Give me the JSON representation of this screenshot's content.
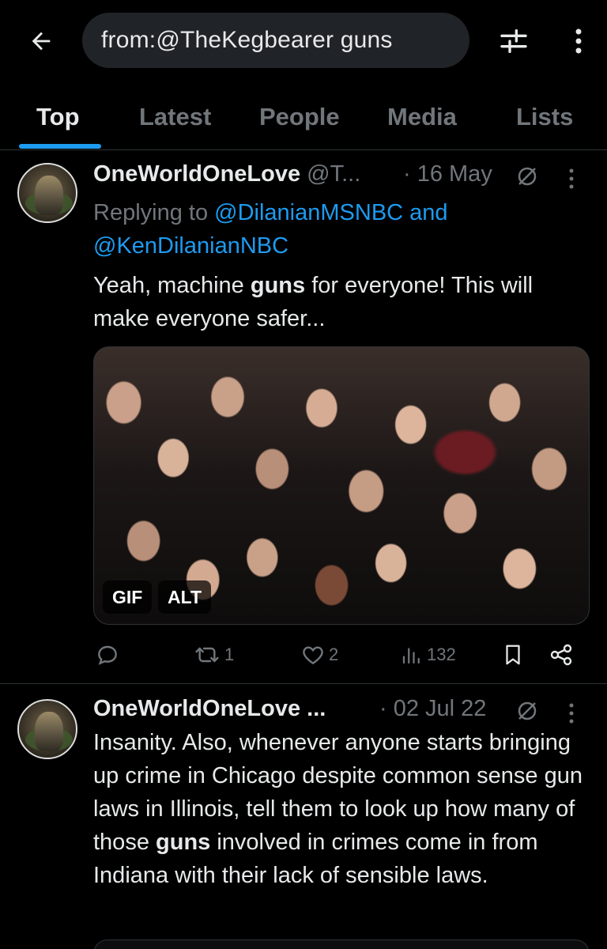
{
  "search": {
    "query": "from:@TheKegbearer guns"
  },
  "tabs": [
    {
      "label": "Top",
      "active": true
    },
    {
      "label": "Latest",
      "active": false
    },
    {
      "label": "People",
      "active": false
    },
    {
      "label": "Media",
      "active": false
    },
    {
      "label": "Lists",
      "active": false
    }
  ],
  "tweets": [
    {
      "name": "OneWorldOneLove",
      "handle": "@T...",
      "date": "· 16 May",
      "reply_prefix": "Replying to",
      "reply_mention_1": "@DilanianMSNBC",
      "reply_and": "and",
      "reply_mention_2": "@KenDilanianNBC",
      "text_before": "Yeah, machine",
      "text_bold": "guns",
      "text_after": "for everyone! This will make everyone safer...",
      "media": {
        "badge_gif": "GIF",
        "badge_alt": "ALT"
      },
      "stats": {
        "retweets": "1",
        "likes": "2",
        "views": "132"
      }
    },
    {
      "name": "OneWorldOneLove ...",
      "date": "· 02 Jul 22",
      "text_before": "Insanity. Also, whenever anyone starts bringing up crime in Chicago despite common sense gun laws in Illinois, tell them to look up how many of those",
      "text_bold": "guns",
      "text_after": "involved in crimes come in from Indiana with their lack of sensible laws."
    }
  ],
  "colors": {
    "background": "#000000",
    "text": "#e7e9ea",
    "secondary": "#71767b",
    "accent": "#1d9bf0",
    "divider": "#2f3336"
  },
  "icons": [
    "back-arrow-icon",
    "filter-sliders-icon",
    "more-vertical-icon",
    "no-reply-icon",
    "reply-icon",
    "retweet-icon",
    "like-icon",
    "views-icon",
    "bookmark-icon",
    "share-icon"
  ]
}
